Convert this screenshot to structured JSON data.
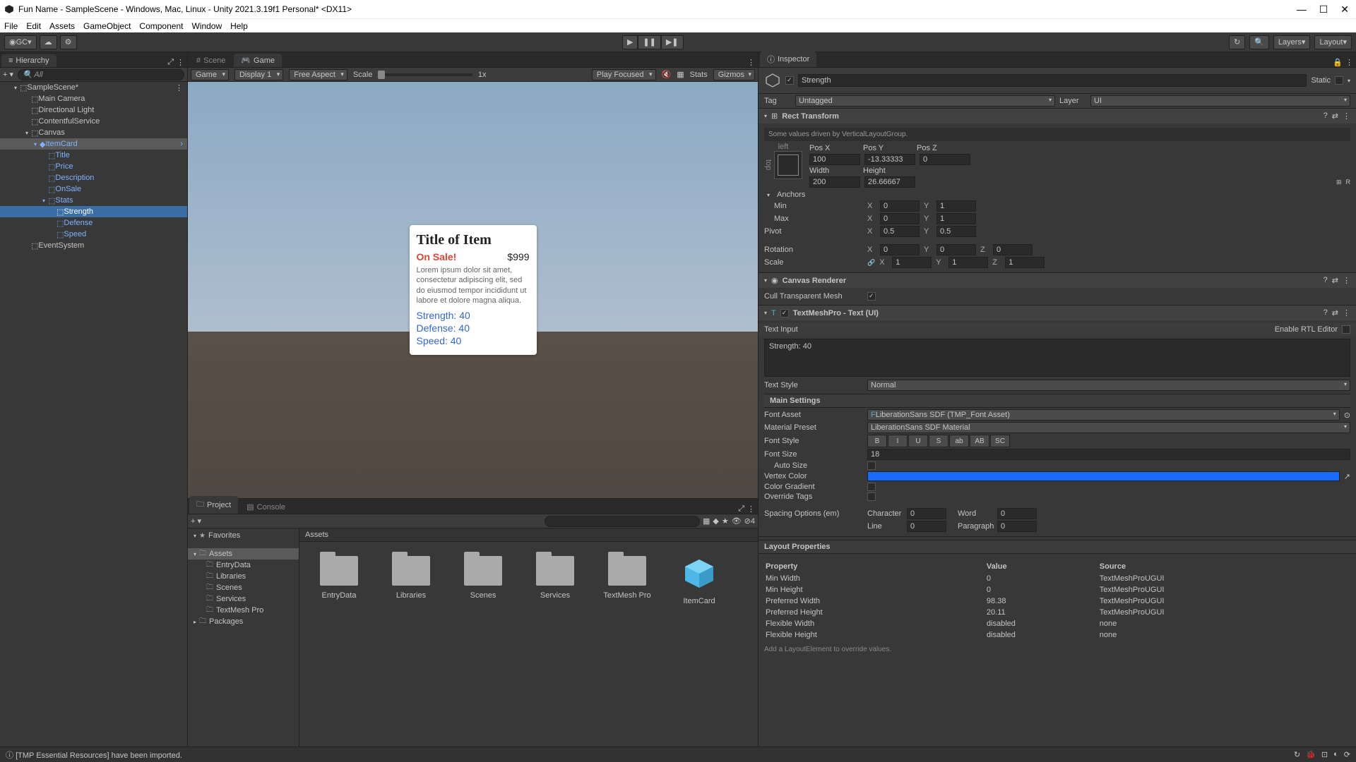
{
  "titlebar": {
    "title": "Fun Name - SampleScene - Windows, Mac, Linux - Unity 2021.3.19f1 Personal* <DX11>"
  },
  "menubar": {
    "items": [
      "File",
      "Edit",
      "Assets",
      "GameObject",
      "Component",
      "Window",
      "Help"
    ]
  },
  "toolbar": {
    "gc_label": "GC",
    "layers": "Layers",
    "layout": "Layout"
  },
  "hierarchy": {
    "tab": "Hierarchy",
    "search_placeholder": "All",
    "scene": "SampleScene*",
    "items": {
      "main_camera": "Main Camera",
      "dir_light": "Directional Light",
      "contentful": "ContentfulService",
      "canvas": "Canvas",
      "itemcard": "ItemCard",
      "title": "Title",
      "price": "Price",
      "description": "Description",
      "onsale": "OnSale",
      "stats": "Stats",
      "strength": "Strength",
      "defense": "Defense",
      "speed": "Speed",
      "eventsystem": "EventSystem"
    }
  },
  "game": {
    "tab_scene": "Scene",
    "tab_game": "Game",
    "game_dropdown": "Game",
    "display": "Display 1",
    "aspect": "Free Aspect",
    "scale_label": "Scale",
    "scale_value": "1x",
    "play_mode": "Play Focused",
    "stats": "Stats",
    "gizmos": "Gizmos"
  },
  "itemcard": {
    "title": "Title of Item",
    "onsale": "On Sale!",
    "price": "$999",
    "desc": "Lorem ipsum dolor sit amet, consectetur adipiscing elit, sed do eiusmod tempor incididunt ut labore et dolore magna aliqua.",
    "stat1": "Strength: 40",
    "stat2": "Defense: 40",
    "stat3": "Speed: 40"
  },
  "project": {
    "tab_project": "Project",
    "tab_console": "Console",
    "favorites": "Favorites",
    "assets": "Assets",
    "entrydata": "EntryData",
    "libraries": "Libraries",
    "scenes": "Scenes",
    "services": "Services",
    "tmp": "TextMesh Pro",
    "packages": "Packages",
    "content_header": "Assets",
    "items": [
      "EntryData",
      "Libraries",
      "Scenes",
      "Services",
      "TextMesh Pro",
      "ItemCard"
    ],
    "thumb_size": "4"
  },
  "inspector": {
    "tab": "Inspector",
    "obj_name": "Strength",
    "static": "Static",
    "tag_label": "Tag",
    "tag": "Untagged",
    "layer_label": "Layer",
    "layer": "UI",
    "rect_transform": {
      "title": "Rect Transform",
      "driven": "Some values driven by VerticalLayoutGroup.",
      "anchor_side1": "left",
      "anchor_side2": "top",
      "posx_label": "Pos X",
      "posx": "100",
      "posy_label": "Pos Y",
      "posy": "-13.33333",
      "posz_label": "Pos Z",
      "posz": "0",
      "width_label": "Width",
      "width": "200",
      "height_label": "Height",
      "height": "26.66667",
      "anchors": "Anchors",
      "min": "Min",
      "min_x": "0",
      "min_y": "1",
      "max": "Max",
      "max_x": "0",
      "max_y": "1",
      "pivot": "Pivot",
      "pivot_x": "0.5",
      "pivot_y": "0.5",
      "rotation": "Rotation",
      "rot_x": "0",
      "rot_y": "0",
      "rot_z": "0",
      "scale": "Scale",
      "scale_x": "1",
      "scale_y": "1",
      "scale_z": "1",
      "x": "X",
      "y": "Y",
      "z": "Z"
    },
    "canvas_renderer": {
      "title": "Canvas Renderer",
      "cull": "Cull Transparent Mesh"
    },
    "tmp": {
      "title": "TextMeshPro - Text (UI)",
      "text_input": "Text Input",
      "rtl": "Enable RTL Editor",
      "text": "Strength: 40",
      "text_style": "Text Style",
      "text_style_val": "Normal",
      "main_settings": "Main Settings",
      "font_asset": "Font Asset",
      "font_asset_val": "LiberationSans SDF (TMP_Font Asset)",
      "material_preset": "Material Preset",
      "material_preset_val": "LiberationSans SDF Material",
      "font_style": "Font Style",
      "font_style_btns": [
        "B",
        "I",
        "U",
        "S",
        "ab",
        "AB",
        "SC"
      ],
      "font_size": "Font Size",
      "font_size_val": "18",
      "auto_size": "Auto Size",
      "vertex_color": "Vertex Color",
      "color_gradient": "Color Gradient",
      "override_tags": "Override Tags",
      "spacing": "Spacing Options (em)",
      "character": "Character",
      "character_val": "0",
      "word": "Word",
      "word_val": "0",
      "line": "Line",
      "line_val": "0",
      "paragraph": "Paragraph",
      "paragraph_val": "0"
    },
    "layout_props": {
      "title": "Layout Properties",
      "h_property": "Property",
      "h_value": "Value",
      "h_source": "Source",
      "rows": [
        {
          "p": "Min Width",
          "v": "0",
          "s": "TextMeshProUGUI"
        },
        {
          "p": "Min Height",
          "v": "0",
          "s": "TextMeshProUGUI"
        },
        {
          "p": "Preferred Width",
          "v": "98.38",
          "s": "TextMeshProUGUI"
        },
        {
          "p": "Preferred Height",
          "v": "20.11",
          "s": "TextMeshProUGUI"
        },
        {
          "p": "Flexible Width",
          "v": "disabled",
          "s": "none"
        },
        {
          "p": "Flexible Height",
          "v": "disabled",
          "s": "none"
        }
      ],
      "add_hint": "Add a LayoutElement to override values."
    }
  },
  "statusbar": {
    "msg": "[TMP Essential Resources] have been imported."
  }
}
